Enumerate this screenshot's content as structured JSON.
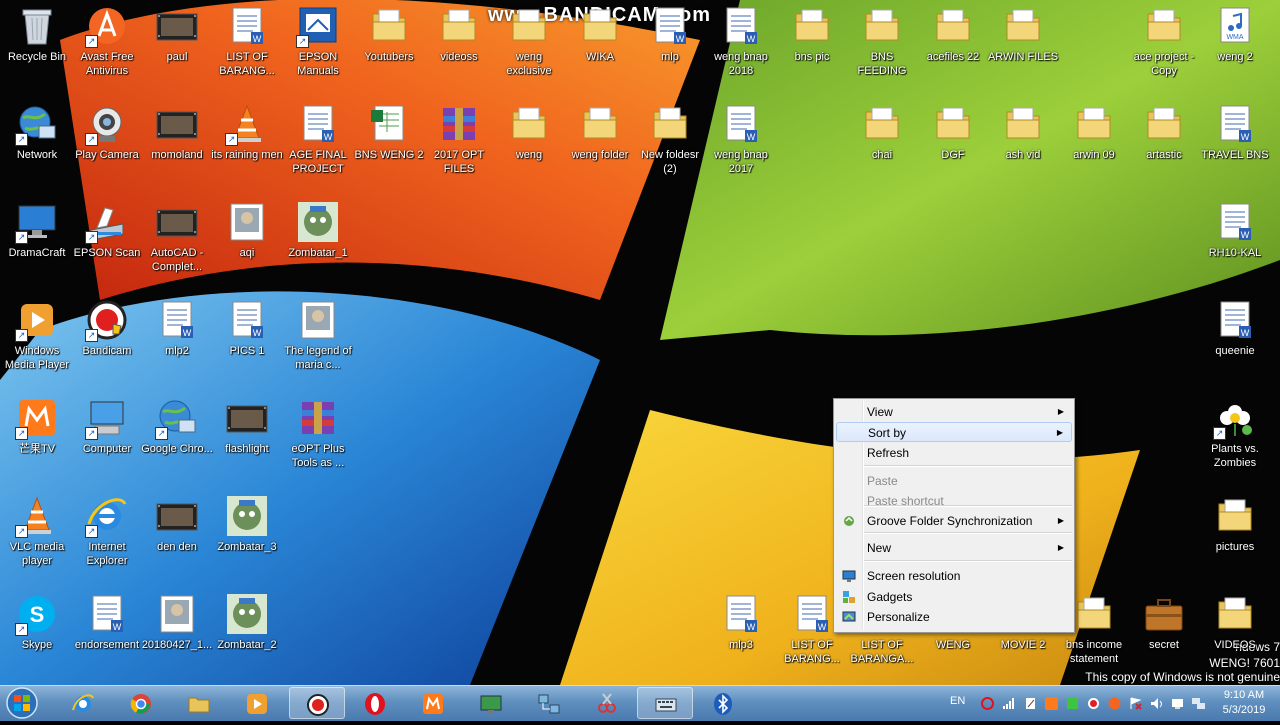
{
  "watermark": "www.BANDICAM.com",
  "not_genuine": "This copy of Windows is not genuine",
  "build_text_1": "ndows 7",
  "build_text_2": "WENG! 7601",
  "icons": [
    {
      "label": "Recycle Bin",
      "icon": "recycle-bin-icon"
    },
    {
      "label": "Avast Free Antivirus",
      "icon": "avast-icon"
    },
    {
      "label": "paul",
      "icon": "video-thumb-icon"
    },
    {
      "label": "LIST OF BARANG...",
      "icon": "word-doc-icon"
    },
    {
      "label": "EPSON Manuals",
      "icon": "epson-manuals-icon"
    },
    {
      "label": "Youtubers",
      "icon": "folder-icon"
    },
    {
      "label": "videoss",
      "icon": "folder-icon"
    },
    {
      "label": "weng exclusive",
      "icon": "folder-icon"
    },
    {
      "label": "WIKA",
      "icon": "folder-icon"
    },
    {
      "label": "mlp",
      "icon": "word-doc-icon"
    },
    {
      "label": "weng bnap 2018",
      "icon": "word-doc-icon"
    },
    {
      "label": "bns pic",
      "icon": "folder-icon"
    },
    {
      "label": "BNS FEEDING",
      "icon": "folder-icon"
    },
    {
      "label": "acefiles 22",
      "icon": "folder-icon"
    },
    {
      "label": "ARWIN FILES",
      "icon": "folder-icon"
    },
    {
      "label": "ace project - Copy",
      "icon": "folder-icon"
    },
    {
      "label": "weng 2",
      "icon": "wma-icon"
    },
    {
      "label": "Network",
      "icon": "network-icon"
    },
    {
      "label": "Play Camera",
      "icon": "camera-icon"
    },
    {
      "label": "momoland",
      "icon": "video-thumb-icon"
    },
    {
      "label": "its raining men",
      "icon": "vlc-icon"
    },
    {
      "label": "AGE FINAL PROJECT",
      "icon": "word-doc-icon"
    },
    {
      "label": "BNS WENG 2",
      "icon": "excel-icon"
    },
    {
      "label": "2017 OPT FILES",
      "icon": "winrar-icon"
    },
    {
      "label": "weng",
      "icon": "folder-icon"
    },
    {
      "label": "weng folder",
      "icon": "folder-icon"
    },
    {
      "label": "New foldesr (2)",
      "icon": "folder-icon"
    },
    {
      "label": "weng bnap 2017",
      "icon": "word-doc-icon"
    },
    {
      "label": "chai",
      "icon": "folder-icon"
    },
    {
      "label": "DGF",
      "icon": "folder-icon"
    },
    {
      "label": "ash vid",
      "icon": "folder-icon"
    },
    {
      "label": "arwin 09",
      "icon": "folder-icon"
    },
    {
      "label": "artastic",
      "icon": "folder-icon"
    },
    {
      "label": "TRAVEL BNS",
      "icon": "word-doc-icon"
    },
    {
      "label": "DramaCraft",
      "icon": "monitor-icon"
    },
    {
      "label": "EPSON Scan",
      "icon": "scanner-icon"
    },
    {
      "label": "AutoCAD - Complet...",
      "icon": "video-thumb-icon"
    },
    {
      "label": "aqi",
      "icon": "image-icon"
    },
    {
      "label": "Zombatar_1",
      "icon": "zombie-icon"
    },
    {
      "label": "RH10-KAL",
      "icon": "word-doc-icon"
    },
    {
      "label": "Windows Media Player",
      "icon": "wmp-icon"
    },
    {
      "label": "Bandicam",
      "icon": "bandicam-icon"
    },
    {
      "label": "mlp2",
      "icon": "word-doc-icon"
    },
    {
      "label": "PICS 1",
      "icon": "word-doc-icon"
    },
    {
      "label": "The legend of maria c...",
      "icon": "image-icon"
    },
    {
      "label": "queenie",
      "icon": "word-doc-icon"
    },
    {
      "label": "芒果TV",
      "icon": "mango-tv-icon"
    },
    {
      "label": "Computer",
      "icon": "computer-icon"
    },
    {
      "label": "Google Chro...",
      "icon": "network-icon"
    },
    {
      "label": "flashlight",
      "icon": "video-thumb-icon"
    },
    {
      "label": "eOPT Plus Tools as ...",
      "icon": "winrar-icon"
    },
    {
      "label": "Plants vs. Zombies",
      "icon": "flower-icon"
    },
    {
      "label": "VLC media player",
      "icon": "vlc-icon"
    },
    {
      "label": "Internet Explorer",
      "icon": "ie-icon"
    },
    {
      "label": "den den",
      "icon": "video-thumb-icon"
    },
    {
      "label": "Zombatar_3",
      "icon": "zombie-icon"
    },
    {
      "label": "pictures",
      "icon": "folder-icon"
    },
    {
      "label": "Skype",
      "icon": "skype-icon"
    },
    {
      "label": "endorsement",
      "icon": "word-doc-icon"
    },
    {
      "label": "20180427_1...",
      "icon": "image-icon"
    },
    {
      "label": "Zombatar_2",
      "icon": "zombie-icon"
    },
    {
      "label": "mlp3",
      "icon": "word-doc-icon"
    },
    {
      "label": "LIST OF BARANG...",
      "icon": "word-doc-icon"
    },
    {
      "label": "LIST OF BARANGA...",
      "icon": "word-doc-icon"
    },
    {
      "label": "WENG",
      "icon": "folder-icon"
    },
    {
      "label": "MOVIE 2",
      "icon": "folder-icon"
    },
    {
      "label": "bns income statement",
      "icon": "folder-icon"
    },
    {
      "label": "secret",
      "icon": "briefcase-icon"
    },
    {
      "label": "VIDEOS",
      "icon": "folder-icon"
    }
  ],
  "context_menu": {
    "items": [
      {
        "label": "View",
        "submenu": true,
        "disabled": false,
        "icon": ""
      },
      {
        "label": "Sort by",
        "submenu": true,
        "disabled": false,
        "icon": "",
        "highlighted": true
      },
      {
        "label": "Refresh",
        "submenu": false,
        "disabled": false,
        "icon": ""
      },
      {
        "label": "Paste",
        "submenu": false,
        "disabled": true,
        "icon": ""
      },
      {
        "label": "Paste shortcut",
        "submenu": false,
        "disabled": true,
        "icon": ""
      },
      {
        "label": "Groove Folder Synchronization",
        "submenu": true,
        "disabled": false,
        "icon": "groove-sync-icon"
      },
      {
        "label": "New",
        "submenu": true,
        "disabled": false,
        "icon": ""
      },
      {
        "label": "Screen resolution",
        "submenu": false,
        "disabled": false,
        "icon": "screen-resolution-icon"
      },
      {
        "label": "Gadgets",
        "submenu": false,
        "disabled": false,
        "icon": "gadgets-icon"
      },
      {
        "label": "Personalize",
        "submenu": false,
        "disabled": false,
        "icon": "personalize-icon"
      }
    ]
  },
  "taskbar": {
    "pinned": [
      {
        "icon": "internet-explorer-icon"
      },
      {
        "icon": "chrome-icon"
      },
      {
        "icon": "file-explorer-icon"
      },
      {
        "icon": "media-player-icon"
      },
      {
        "icon": "bandicam-icon"
      },
      {
        "icon": "opera-icon"
      },
      {
        "icon": "mango-tv-icon"
      },
      {
        "icon": "screen-app-icon"
      },
      {
        "icon": "network-app-icon"
      },
      {
        "icon": "snipping-icon"
      },
      {
        "icon": "keyboard-icon"
      },
      {
        "icon": "bluetooth-icon"
      }
    ],
    "language": "EN",
    "time": "9:10 AM",
    "date": "5/3/2019"
  }
}
